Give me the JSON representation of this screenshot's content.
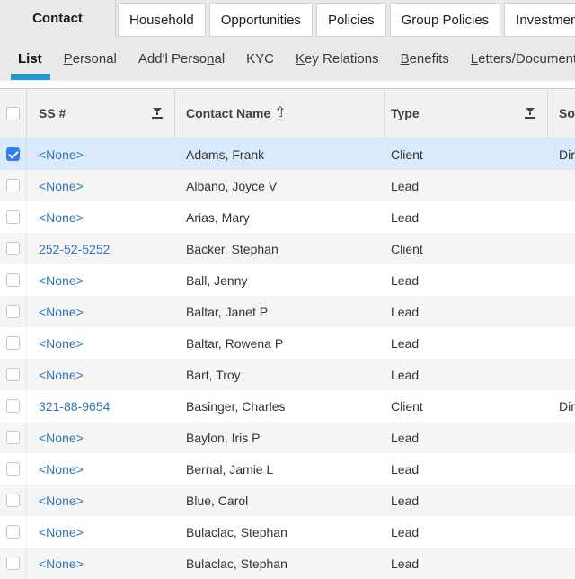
{
  "main_tabs": [
    {
      "label": "Contact",
      "active": true
    },
    {
      "label": "Household",
      "active": false
    },
    {
      "label": "Opportunities",
      "active": false
    },
    {
      "label": "Policies",
      "active": false
    },
    {
      "label": "Group Policies",
      "active": false
    },
    {
      "label": "Investment Accounts",
      "active": false
    }
  ],
  "sub_tabs": [
    {
      "label": "List",
      "active": true,
      "accel_index": -1
    },
    {
      "label": "Personal",
      "active": false,
      "accel_index": 0
    },
    {
      "label": "Add'l Personal",
      "active": false,
      "accel_index": 11
    },
    {
      "label": "KYC",
      "active": false,
      "accel_index": -1
    },
    {
      "label": "Key Relations",
      "active": false,
      "accel_index": 0
    },
    {
      "label": "Benefits",
      "active": false,
      "accel_index": 0
    },
    {
      "label": "Letters/Documents",
      "active": false,
      "accel_index": 0
    }
  ],
  "table": {
    "columns": [
      {
        "label": "SS #",
        "filter_icon": "funnel-filter-icon"
      },
      {
        "label": "Contact Name",
        "sort": "ascending",
        "sort_icon": "up-arrow-icon"
      },
      {
        "label": "Type",
        "filter_icon": "funnel-filter-icon"
      },
      {
        "label": "Source"
      }
    ],
    "rows": [
      {
        "ss": "<None>",
        "name": "Adams, Frank",
        "type": "Client",
        "source": "Direct",
        "checked": true,
        "selected": true
      },
      {
        "ss": "<None>",
        "name": "Albano, Joyce V",
        "type": "Lead",
        "source": "",
        "checked": false,
        "selected": false
      },
      {
        "ss": "<None>",
        "name": "Arias, Mary",
        "type": "Lead",
        "source": "",
        "checked": false,
        "selected": false
      },
      {
        "ss": "252-52-5252",
        "name": "Backer, Stephan",
        "type": "Client",
        "source": "",
        "checked": false,
        "selected": false
      },
      {
        "ss": "<None>",
        "name": "Ball, Jenny",
        "type": "Lead",
        "source": "",
        "checked": false,
        "selected": false
      },
      {
        "ss": "<None>",
        "name": "Baltar, Janet P",
        "type": "Lead",
        "source": "",
        "checked": false,
        "selected": false
      },
      {
        "ss": "<None>",
        "name": "Baltar, Rowena P",
        "type": "Lead",
        "source": "",
        "checked": false,
        "selected": false
      },
      {
        "ss": "<None>",
        "name": "Bart, Troy",
        "type": "Lead",
        "source": "",
        "checked": false,
        "selected": false
      },
      {
        "ss": "321-88-9654",
        "name": "Basinger, Charles",
        "type": "Client",
        "source": "Direct",
        "checked": false,
        "selected": false
      },
      {
        "ss": "<None>",
        "name": "Baylon, Iris P",
        "type": "Lead",
        "source": "",
        "checked": false,
        "selected": false
      },
      {
        "ss": "<None>",
        "name": "Bernal, Jamie L",
        "type": "Lead",
        "source": "",
        "checked": false,
        "selected": false
      },
      {
        "ss": "<None>",
        "name": "Blue, Carol",
        "type": "Lead",
        "source": "",
        "checked": false,
        "selected": false
      },
      {
        "ss": "<None>",
        "name": "Bulaclac, Stephan",
        "type": "Lead",
        "source": "",
        "checked": false,
        "selected": false
      },
      {
        "ss": "<None>",
        "name": "Bulaclac, Stephan",
        "type": "Lead",
        "source": "",
        "checked": false,
        "selected": false
      }
    ]
  },
  "colors": {
    "active_subtab_underline": "#1f9ad6",
    "link_blue": "#2e74b5",
    "selected_row_background": "#d9eafc",
    "checked_checkbox_blue": "#2f7ff2",
    "tab_bar_background": "#e9e9e9",
    "header_background": "#f1f1f1",
    "alt_row_background": "#f5f5f5"
  }
}
